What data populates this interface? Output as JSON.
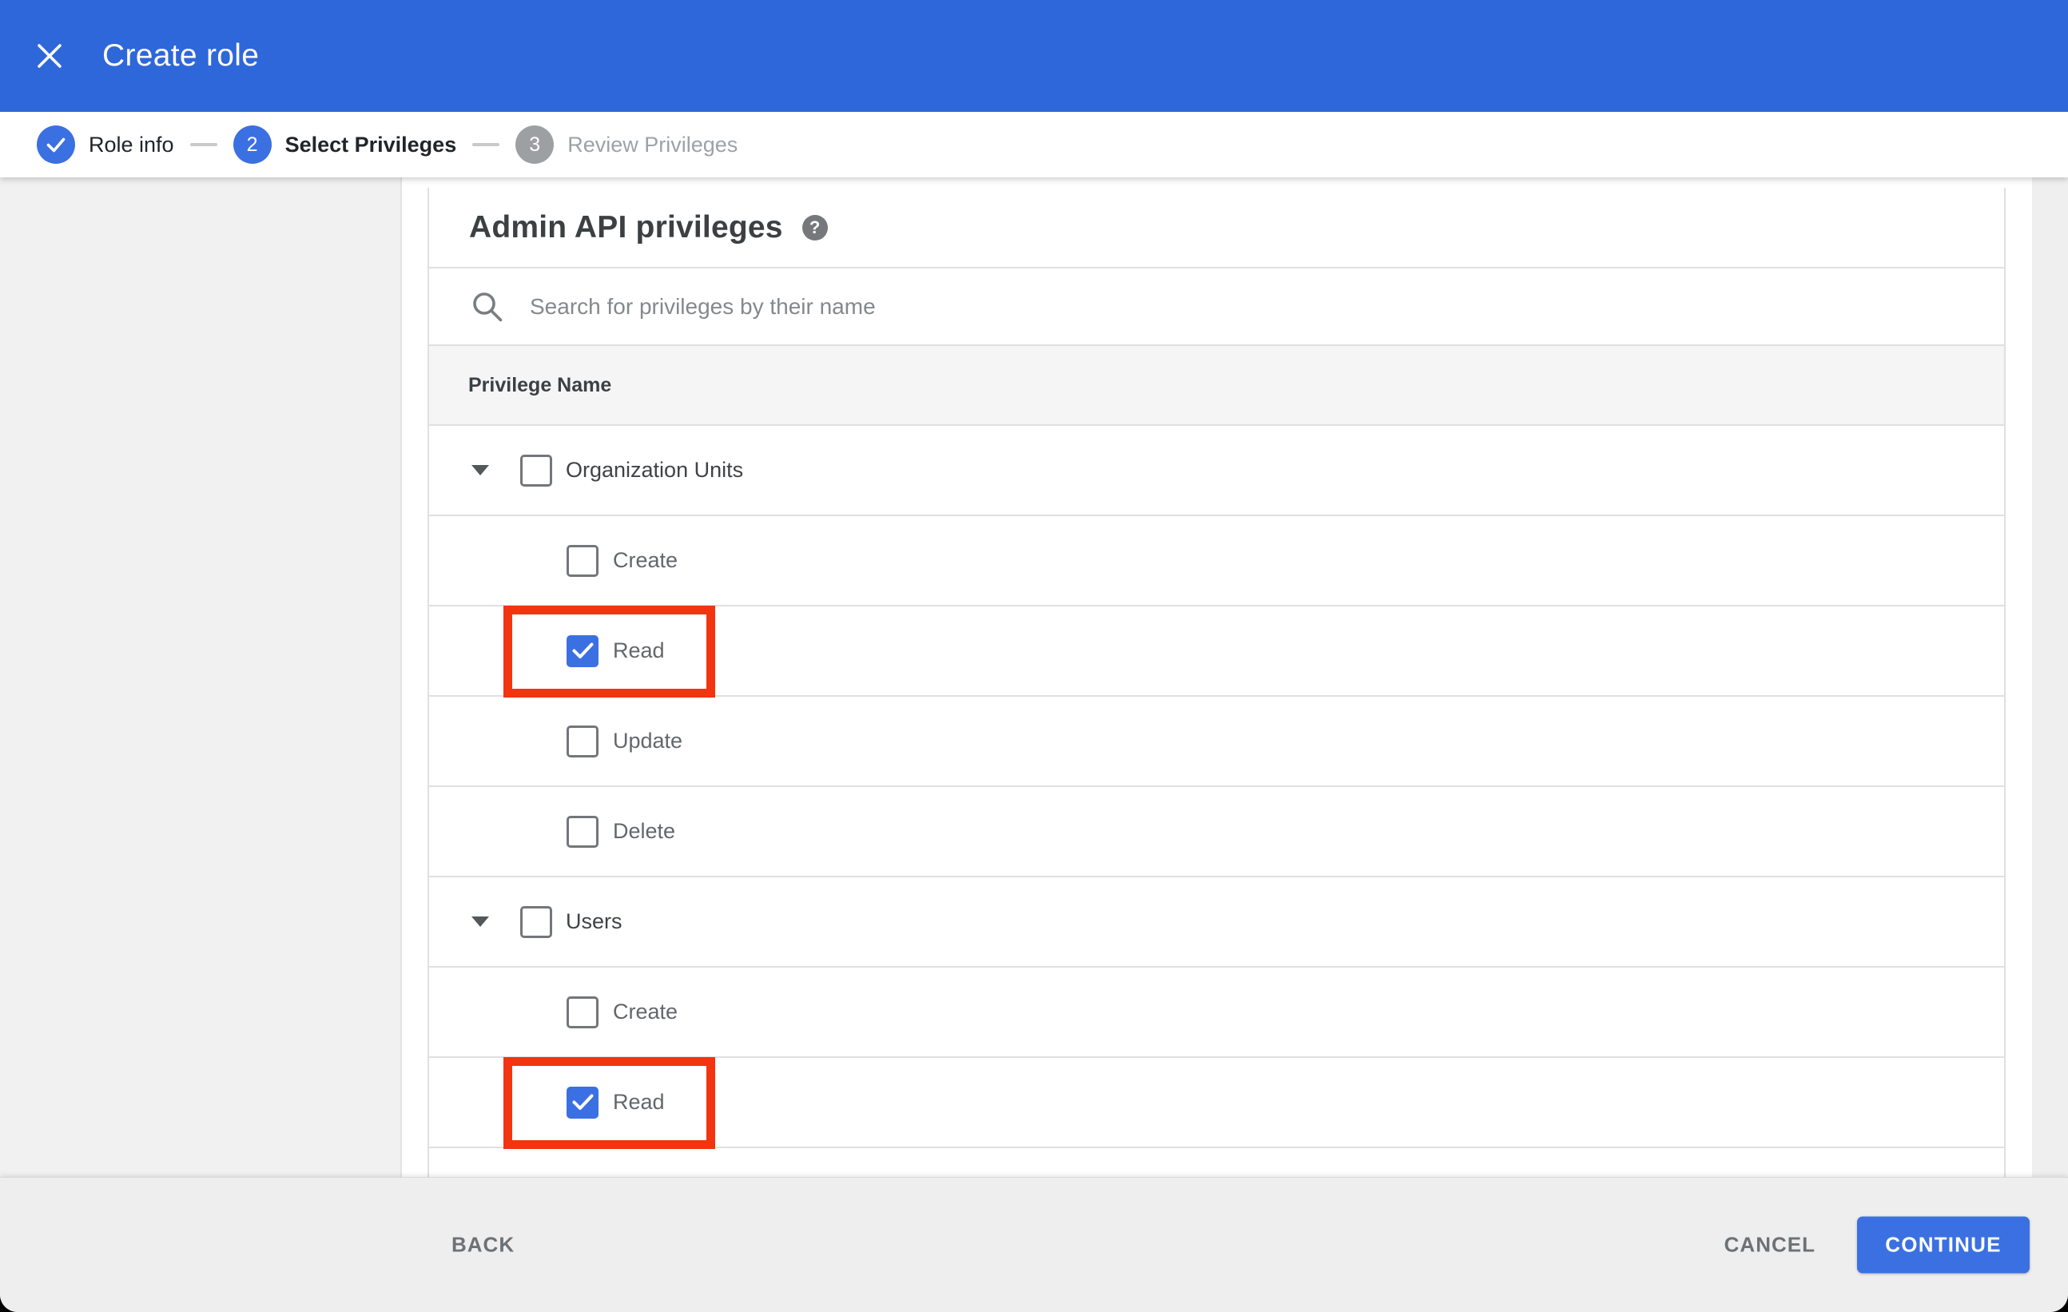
{
  "appbar": {
    "title": "Create role"
  },
  "stepper": {
    "steps": [
      {
        "number": "1",
        "label": "Role info",
        "state": "completed"
      },
      {
        "number": "2",
        "label": "Select Privileges",
        "state": "active"
      },
      {
        "number": "3",
        "label": "Review Privileges",
        "state": "upcoming"
      }
    ]
  },
  "content": {
    "heading": "Admin API privileges",
    "help_icon": "?",
    "search": {
      "placeholder": "Search for privileges by their name",
      "value": ""
    },
    "table": {
      "header": "Privilege Name",
      "rows": [
        {
          "type": "group",
          "label": "Organization Units",
          "checked": false,
          "highlighted": false
        },
        {
          "type": "child",
          "label": "Create",
          "checked": false,
          "highlighted": false
        },
        {
          "type": "child",
          "label": "Read",
          "checked": true,
          "highlighted": true
        },
        {
          "type": "child",
          "label": "Update",
          "checked": false,
          "highlighted": false
        },
        {
          "type": "child",
          "label": "Delete",
          "checked": false,
          "highlighted": false
        },
        {
          "type": "group",
          "label": "Users",
          "checked": false,
          "highlighted": false
        },
        {
          "type": "child",
          "label": "Create",
          "checked": false,
          "highlighted": false
        },
        {
          "type": "child",
          "label": "Read",
          "checked": true,
          "highlighted": true
        },
        {
          "type": "partial",
          "label": "",
          "checked": false,
          "highlighted": false
        }
      ]
    }
  },
  "footer": {
    "back": "BACK",
    "cancel": "CANCEL",
    "continue": "CONTINUE"
  },
  "colors": {
    "appbar_bg": "#2e67d9",
    "accent_blue": "#3b70e2",
    "highlight_red": "#f23411",
    "step_inactive": "#9da0a3"
  }
}
